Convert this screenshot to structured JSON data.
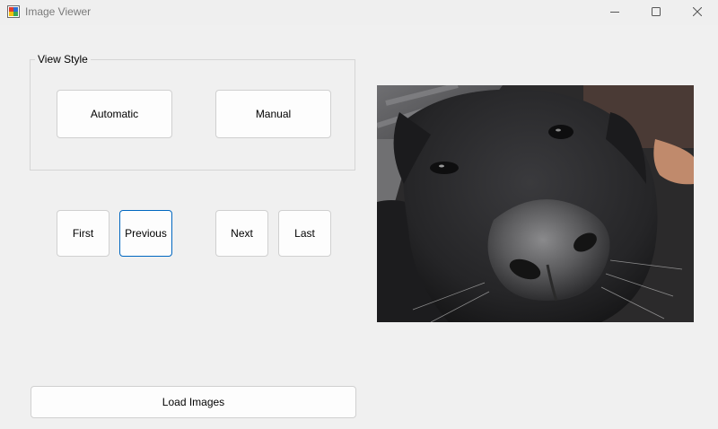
{
  "window": {
    "title": "Image Viewer",
    "icon": "app-icon"
  },
  "caption_buttons": {
    "minimize_icon": "minimize-icon",
    "maximize_icon": "maximize-icon",
    "close_icon": "close-icon"
  },
  "view_style": {
    "legend": "View Style",
    "automatic_label": "Automatic",
    "manual_label": "Manual"
  },
  "navigation": {
    "first_label": "First",
    "previous_label": "Previous",
    "next_label": "Next",
    "last_label": "Last"
  },
  "load": {
    "label": "Load Images"
  },
  "image": {
    "subject": "black dog close-up photo"
  },
  "colors": {
    "window_bg": "#f0f0f0",
    "focus_border": "#0067c0",
    "button_bg": "#fdfdfd"
  }
}
